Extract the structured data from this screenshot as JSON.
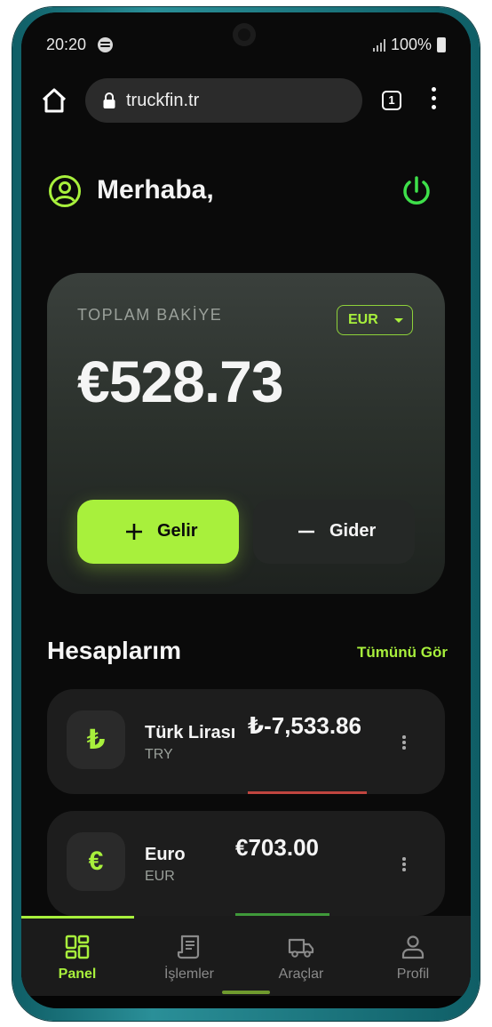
{
  "status_bar": {
    "time": "20:20",
    "battery": "100%"
  },
  "browser": {
    "url": "truckfin.tr",
    "tab_count": "1"
  },
  "header": {
    "greeting": "Merhaba,"
  },
  "balance_card": {
    "label": "TOPLAM BAKİYE",
    "currency": "EUR",
    "amount": "€528.73",
    "income_label": "Gelir",
    "expense_label": "Gider"
  },
  "accounts_section": {
    "title": "Hesaplarım",
    "see_all": "Tümünü Gör",
    "accounts": [
      {
        "symbol": "₺",
        "name": "Türk Lirası",
        "code": "TRY",
        "amount": "₺-7,533.86",
        "bar_color": "#c0453f"
      },
      {
        "symbol": "€",
        "name": "Euro",
        "code": "EUR",
        "amount": "€703.00",
        "bar_color": "#3f9a3a"
      }
    ]
  },
  "bottom_nav": {
    "items": [
      {
        "label": "Panel",
        "icon": "dashboard-icon",
        "active": true
      },
      {
        "label": "İşlemler",
        "icon": "receipt-icon",
        "active": false
      },
      {
        "label": "Araçlar",
        "icon": "truck-icon",
        "active": false
      },
      {
        "label": "Profil",
        "icon": "user-icon",
        "active": false
      }
    ]
  },
  "colors": {
    "accent": "#a8f03c",
    "background": "#0a0a0a",
    "card": "#1d1d1d"
  }
}
